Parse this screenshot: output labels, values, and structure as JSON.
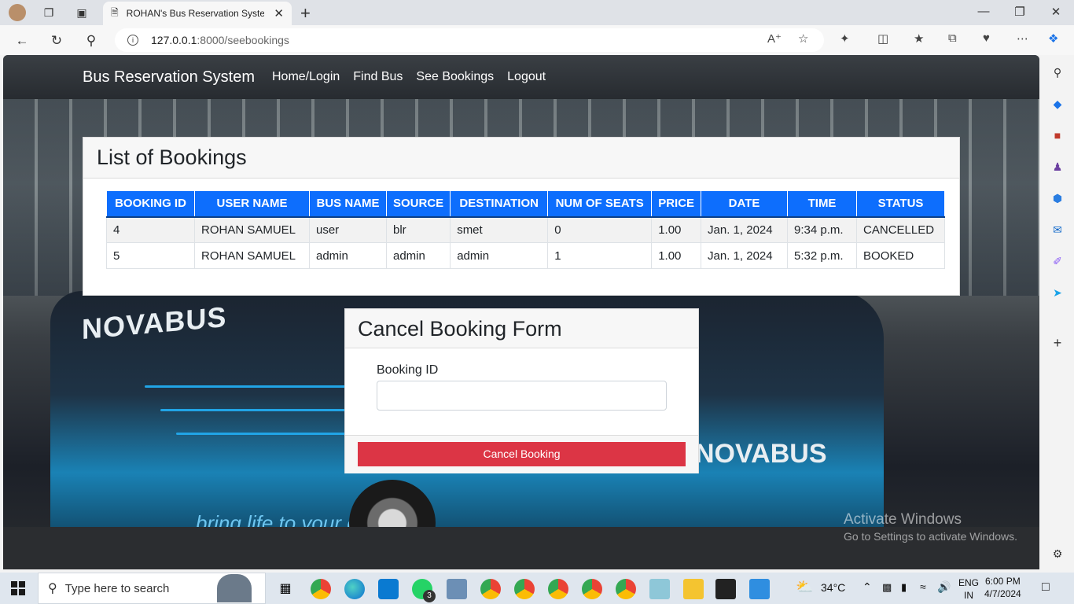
{
  "browser": {
    "tab_title": "ROHAN's Bus Reservation System",
    "url_host": "127.0.0.1",
    "url_path": ":8000/seebookings"
  },
  "navbar": {
    "brand": "Bus Reservation System",
    "links": [
      "Home/Login",
      "Find Bus",
      "See Bookings",
      "Logout"
    ]
  },
  "bookings": {
    "title": "List of Bookings",
    "columns": [
      "BOOKING ID",
      "USER NAME",
      "BUS NAME",
      "SOURCE",
      "DESTINATION",
      "NUM OF SEATS",
      "PRICE",
      "DATE",
      "TIME",
      "STATUS"
    ],
    "rows": [
      [
        "4",
        "ROHAN SAMUEL",
        "user",
        "blr",
        "smet",
        "0",
        "1.00",
        "Jan. 1, 2024",
        "9:34 p.m.",
        "CANCELLED"
      ],
      [
        "5",
        "ROHAN SAMUEL",
        "admin",
        "admin",
        "admin",
        "1",
        "1.00",
        "Jan. 1, 2024",
        "5:32 p.m.",
        "BOOKED"
      ]
    ]
  },
  "cancel_form": {
    "title": "Cancel Booking Form",
    "booking_id_label": "Booking ID",
    "booking_id_value": "",
    "submit_label": "Cancel Booking"
  },
  "background": {
    "bus_logo": "NOVABUS",
    "bus_logo_side": "NOVABUS",
    "bus_slogan": "bring life to your city"
  },
  "watermark": {
    "line1": "Activate Windows",
    "line2": "Go to Settings to activate Windows."
  },
  "taskbar": {
    "search_placeholder": "Type here to search",
    "weather": "34°C",
    "lang": "ENG",
    "region": "IN",
    "time": "6:00 PM",
    "date": "4/7/2024",
    "whatsapp_badge": "3"
  },
  "colors": {
    "table_header": "#0d6efd",
    "cancel_button": "#dc3545",
    "navbar": "#272b30"
  }
}
